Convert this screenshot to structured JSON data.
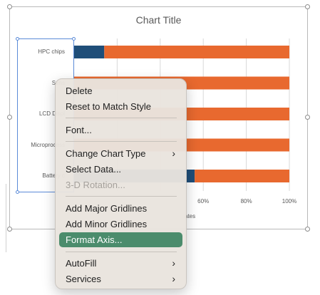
{
  "chart": {
    "title": "Chart Title",
    "axis_title_fragment": "ates"
  },
  "chart_data": {
    "type": "bar",
    "title": "Chart Title",
    "orientation": "horizontal",
    "stacked": "100%",
    "categories": [
      "HPC chips",
      "Sens",
      "LCD Displ",
      "Microprocess",
      "Battery c"
    ],
    "x_ticks": [
      "60%",
      "80%",
      "100%"
    ],
    "xlim": [
      0,
      100
    ],
    "series": [
      {
        "color": "#1f4e79",
        "values": [
          14,
          0,
          0,
          0,
          56
        ]
      },
      {
        "color": "#e8692f",
        "values": [
          86,
          100,
          100,
          100,
          44
        ]
      }
    ],
    "grid": "vertical"
  },
  "menu": {
    "items": [
      {
        "label": "Delete",
        "enabled": true
      },
      {
        "label": "Reset to Match Style",
        "enabled": true
      },
      {
        "label": "Font...",
        "enabled": true
      },
      {
        "label": "Change Chart Type",
        "enabled": true,
        "submenu": true
      },
      {
        "label": "Select Data...",
        "enabled": true
      },
      {
        "label": "3-D Rotation...",
        "enabled": false
      },
      {
        "label": "Add Major Gridlines",
        "enabled": true
      },
      {
        "label": "Add Minor Gridlines",
        "enabled": true
      },
      {
        "label": "Format Axis...",
        "enabled": true,
        "highlighted": true
      },
      {
        "label": "AutoFill",
        "enabled": true,
        "submenu": true
      },
      {
        "label": "Services",
        "enabled": true,
        "submenu": true
      }
    ],
    "submenu_glyph": "›"
  },
  "colors": {
    "accent": "#4b8c6c",
    "series_dark": "#1f4e79",
    "series_orange": "#e8692f",
    "selection": "#5b8bd8"
  }
}
